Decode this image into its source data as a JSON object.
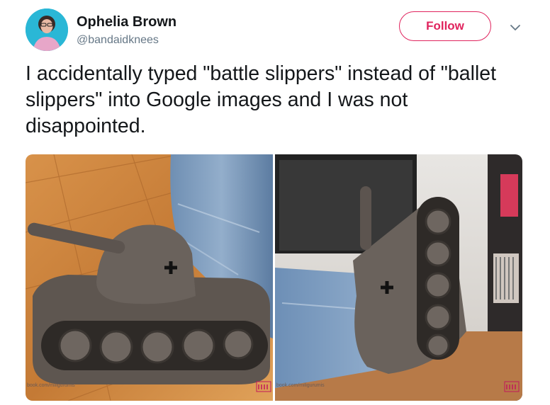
{
  "user": {
    "name": "Ophelia Brown",
    "handle": "@bandaidknees"
  },
  "actions": {
    "follow_label": "Follow"
  },
  "icons": {
    "chevron": "chevron-down-icon"
  },
  "tweet": {
    "text": "I accidentally typed \"battle slippers\" instead of \"ballet slippers\" into Google images and I was not disappointed."
  },
  "media": {
    "photo_left": {
      "watermark": "book.com/miligurumis"
    },
    "photo_right": {
      "watermark": "book.com/miligurumis"
    }
  },
  "colors": {
    "accent": "#e0245e",
    "text": "#14171a",
    "secondary": "#657786"
  }
}
